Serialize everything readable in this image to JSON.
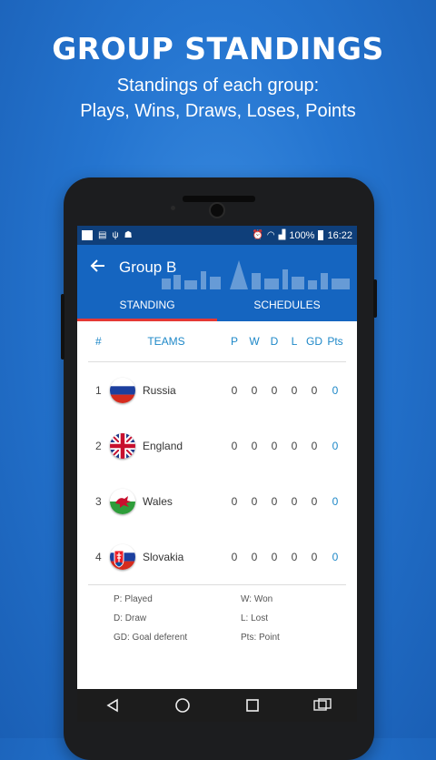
{
  "promo": {
    "title": "GROUP STANDINGS",
    "subtitle_line1": "Standings of each group:",
    "subtitle_line2": "Plays, Wins, Draws, Loses, Points"
  },
  "status_bar": {
    "battery": "100%",
    "time": "16:22"
  },
  "toolbar": {
    "title": "Group B"
  },
  "tabs": [
    {
      "label": "STANDING",
      "active": true
    },
    {
      "label": "SCHEDULES",
      "active": false
    }
  ],
  "table": {
    "headers": {
      "pos": "#",
      "team": "TEAMS",
      "p": "P",
      "w": "W",
      "d": "D",
      "l": "L",
      "gd": "GD",
      "pts": "Pts"
    },
    "rows": [
      {
        "pos": "1",
        "team": "Russia",
        "p": "0",
        "w": "0",
        "d": "0",
        "l": "0",
        "gd": "0",
        "pts": "0"
      },
      {
        "pos": "2",
        "team": "England",
        "p": "0",
        "w": "0",
        "d": "0",
        "l": "0",
        "gd": "0",
        "pts": "0"
      },
      {
        "pos": "3",
        "team": "Wales",
        "p": "0",
        "w": "0",
        "d": "0",
        "l": "0",
        "gd": "0",
        "pts": "0"
      },
      {
        "pos": "4",
        "team": "Slovakia",
        "p": "0",
        "w": "0",
        "d": "0",
        "l": "0",
        "gd": "0",
        "pts": "0"
      }
    ]
  },
  "legend": {
    "played": "P: Played",
    "won": "W: Won",
    "draw": "D: Draw",
    "lost": "L: Lost",
    "goal": "GD: Goal deferent",
    "points": "Pts: Point"
  },
  "colors": {
    "background": "#2474cf",
    "toolbar": "#1565c0",
    "accent": "#1e88c8",
    "tab_indicator": "#e53935"
  }
}
